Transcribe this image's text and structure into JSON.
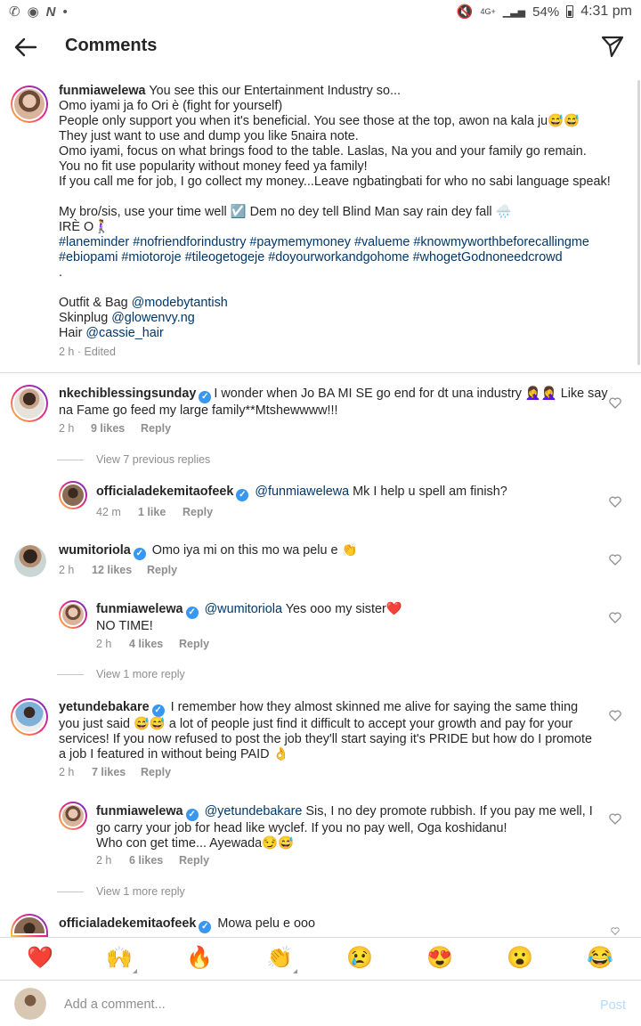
{
  "status_bar": {
    "left_icons": [
      "whatsapp-icon",
      "opera-icon",
      "news-icon"
    ],
    "network": "4G+",
    "battery": "54%",
    "time": "4:31 pm"
  },
  "header": {
    "title": "Comments"
  },
  "caption": {
    "username": "funmiawelewa",
    "lines": [
      "You see this our Entertainment Industry so...",
      "Omo iyami ja fo Ori è (fight for yourself)",
      "People only support you when it's beneficial. You see those at the top, awon na kala ju😅😅",
      "They just want to use and dump you like 5naira note.",
      "Omo iyami, focus on what brings food to the table. Laslas, Na you and your family go remain.",
      "You no fit use popularity without money feed ya family!",
      "If you call me for job, I go collect my money...Leave ngbatingbati for who no sabi language speak!",
      "",
      "My bro/sis, use your time well ☑️ Dem no dey tell Blind Man say rain dey fall 🌧️",
      "IRÈ O🚶‍♀️"
    ],
    "hashtag_lines": [
      "#laneminder #nofriendforindustry #paymemymoney #valueme #knowmyworthbeforecallingme",
      "#ebiopami #miotoroje #tileogetogeje #doyourworkandgohome #whogetGodnoneedcrowd"
    ],
    "dot": ".",
    "credits": [
      {
        "label": "Outfit & Bag",
        "handle": "@modebytantish"
      },
      {
        "label": "Skinplug",
        "handle": "@glowenvy.ng"
      },
      {
        "label": "Hair",
        "handle": "@cassie_hair"
      }
    ],
    "meta": "2 h · Edited"
  },
  "comments": [
    {
      "username": "nkechiblessingsunday",
      "verified": true,
      "line1": "I wonder when Jo BA MI SE go end for dt una industry 🤦‍♀️🤦‍♀️ Like say",
      "line2": "na Fame go feed my large family**Mtshewwww!!!",
      "time": "2 h",
      "likes": "9 likes",
      "reply": "Reply"
    },
    {
      "view_replies": "View 7 previous replies"
    },
    {
      "username": "officialadekemitaofeek",
      "verified": true,
      "mention": "@funmiawelewa",
      "text": "Mk I help u spell am finish?",
      "time": "42 m",
      "likes": "1 like",
      "reply": "Reply"
    },
    {
      "username": "wumitoriola",
      "verified": true,
      "text": "Omo iya mi on this mo wa pelu e 👏",
      "time": "2 h",
      "likes": "12 likes",
      "reply": "Reply"
    },
    {
      "username": "funmiawelewa",
      "verified": true,
      "mention": "@wumitoriola",
      "text": "Yes ooo my sister❤️",
      "line2": "NO TIME!",
      "time": "2 h",
      "likes": "4 likes",
      "reply": "Reply"
    },
    {
      "view_replies": "View 1 more reply"
    },
    {
      "username": "yetundebakare",
      "verified": true,
      "line1": "I remember how they almost skinned me alive for saying the same thing",
      "line2": "you just said 😅😅 a lot of people just find it difficult to accept your growth and pay for your",
      "line3": "services! If you now refused to post the job they'll start saying it's PRIDE  but how do I promote",
      "line4": "a job I featured in without being PAID 👌",
      "time": "2 h",
      "likes": "7 likes",
      "reply": "Reply"
    },
    {
      "username": "funmiawelewa",
      "verified": true,
      "mention": "@yetundebakare",
      "line1": "Sis, I no dey promote rubbish. If you pay me well, I",
      "line2": "go carry your job for head like wyclef. If you no pay well, Oga koshidanu!",
      "line3": "Who con get time... Ayewada😏😅",
      "time": "2 h",
      "likes": "6 likes",
      "reply": "Reply"
    },
    {
      "view_replies": "View 1 more reply"
    },
    {
      "username": "officialadekemitaofeek",
      "verified": true,
      "text": "Mowa pelu e ooo"
    }
  ],
  "emoji_bar": [
    "❤️",
    "🙌",
    "🔥",
    "👏",
    "😢",
    "😍",
    "😮",
    "😂"
  ],
  "compose": {
    "placeholder": "Add a comment...",
    "post": "Post"
  },
  "colors": {
    "link": "#00376b",
    "verified": "#3897f0",
    "meta": "#8e8e8e",
    "post_disabled": "#b3dbff"
  }
}
